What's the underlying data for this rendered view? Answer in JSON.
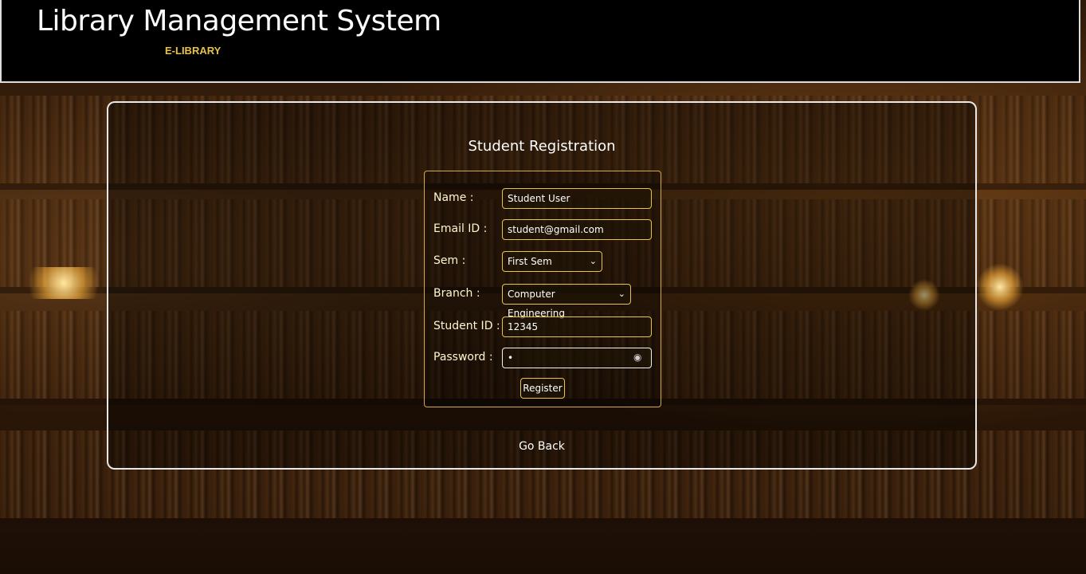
{
  "header": {
    "title": "Library Management System",
    "subtitle": "E-LIBRARY"
  },
  "form": {
    "title": "Student Registration",
    "fields": {
      "name": {
        "label": "Name :",
        "value": "Student User"
      },
      "email": {
        "label": "Email ID :",
        "value": "student@gmail.com"
      },
      "sem": {
        "label": "Sem :",
        "value": "First Sem"
      },
      "branch": {
        "label": "Branch :",
        "value": "Computer Engineering"
      },
      "student_id": {
        "label": "Student ID :",
        "value": "12345"
      },
      "password": {
        "label": "Password :",
        "value": "•"
      }
    },
    "register_label": "Register",
    "go_back_label": "Go Back"
  },
  "icons": {
    "select_chevron": "chevron-down-icon",
    "password_toggle": "eye-icon"
  },
  "colors": {
    "accent": "#e7c34a",
    "header_bg": "#000000",
    "subtitle": "#e6c24a"
  }
}
